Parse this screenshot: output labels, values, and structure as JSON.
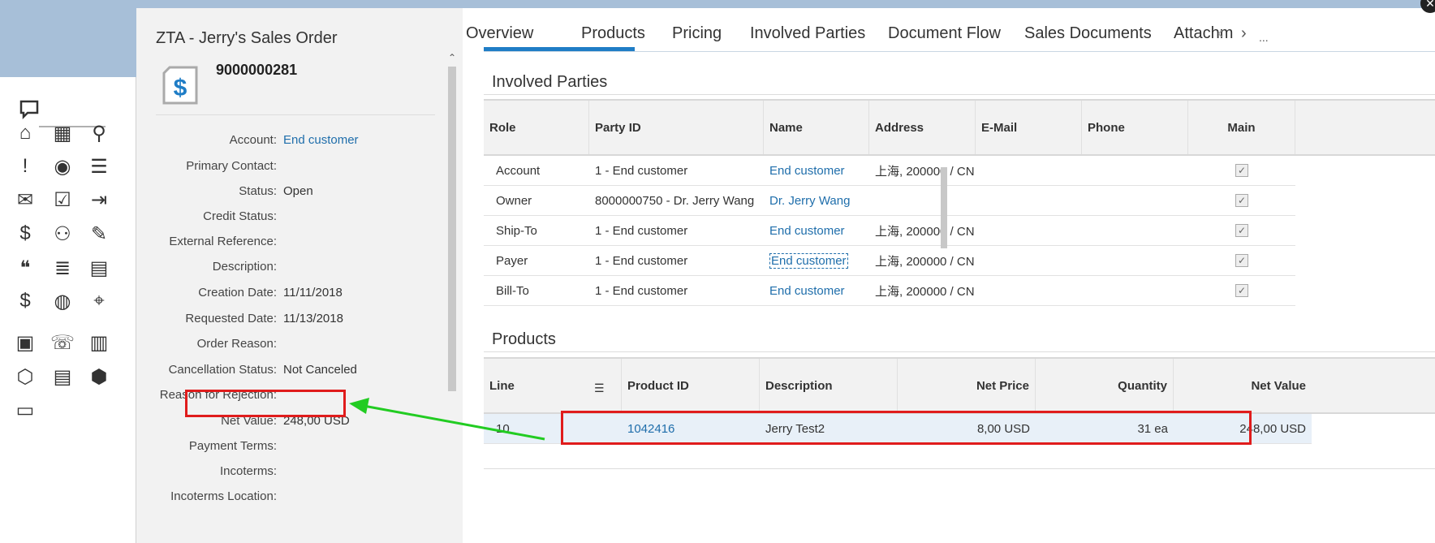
{
  "header": {
    "title": "ZTA - Jerry's Sales Order",
    "object_number": "9000000281"
  },
  "fields": [
    {
      "label": "Account:",
      "value": "End customer",
      "link": true
    },
    {
      "label": "Primary Contact:",
      "value": ""
    },
    {
      "label": "Status:",
      "value": "Open"
    },
    {
      "label": "Credit Status:",
      "value": ""
    },
    {
      "label": "External Reference:",
      "value": ""
    },
    {
      "label": "Description:",
      "value": ""
    },
    {
      "label": "Creation Date:",
      "value": "11/11/2018"
    },
    {
      "label": "Requested Date:",
      "value": "11/13/2018"
    },
    {
      "label": "Order Reason:",
      "value": ""
    },
    {
      "label": "Cancellation Status:",
      "value": "Not Canceled"
    },
    {
      "label": "Reason for Rejection:",
      "value": ""
    },
    {
      "label": "Net Value:",
      "value": "248,00 USD"
    },
    {
      "label": "Payment Terms:",
      "value": ""
    },
    {
      "label": "Incoterms:",
      "value": ""
    },
    {
      "label": "Incoterms Location:",
      "value": ""
    }
  ],
  "tabs": [
    "Overview",
    "Products",
    "Pricing",
    "Involved Parties",
    "Document Flow",
    "Sales Documents",
    "Attachm"
  ],
  "tab_nav": {
    "prev": "‹",
    "next": "›",
    "more": "..."
  },
  "involved_parties": {
    "title": "Involved Parties",
    "columns": [
      "Role",
      "Party ID",
      "Name",
      "Address",
      "E-Mail",
      "Phone",
      "Main"
    ],
    "rows": [
      {
        "role": "Account",
        "party_id": "1 - End customer",
        "name": "End customer",
        "address": "上海, 200000 / CN",
        "email": "",
        "phone": "",
        "main": true
      },
      {
        "role": "Owner",
        "party_id": "8000000750 - Dr. Jerry Wang",
        "name": "Dr. Jerry Wang",
        "address": "",
        "email": "",
        "phone": "",
        "main": true
      },
      {
        "role": "Ship-To",
        "party_id": "1 - End customer",
        "name": "End customer",
        "address": "上海, 200000 / CN",
        "email": "",
        "phone": "",
        "main": true
      },
      {
        "role": "Payer",
        "party_id": "1 - End customer",
        "name": "End customer",
        "address": "上海, 200000 / CN",
        "email": "",
        "phone": "",
        "main": true
      },
      {
        "role": "Bill-To",
        "party_id": "1 - End customer",
        "name": "End customer",
        "address": "上海, 200000 / CN",
        "email": "",
        "phone": "",
        "main": true
      }
    ]
  },
  "products": {
    "title": "Products",
    "columns": [
      "Line",
      "Product ID",
      "Description",
      "Net Price",
      "Quantity",
      "Net Value"
    ],
    "rows": [
      {
        "line": "10",
        "product_id": "1042416",
        "description": "Jerry Test2",
        "net_price": "8,00  USD",
        "quantity": "31  ea",
        "net_value": "248,00  USD"
      }
    ]
  },
  "launcher_icons": [
    "feedback-icon",
    "home-icon",
    "calendar-icon",
    "search-icon",
    "alert-icon",
    "person-icon",
    "contacts-icon",
    "mail-icon",
    "checklist-icon",
    "transfer-money-icon",
    "dollar-icon",
    "org-icon",
    "edit-doc-icon",
    "quote-icon",
    "list-icon",
    "notebook-icon",
    "invoice-icon",
    "globe-money-icon",
    "map-pin-icon",
    "appointment-icon",
    "phone-book-icon",
    "clipboard-icon",
    "box-icon",
    "document-icon",
    "package-icon",
    "car-icon"
  ],
  "colors": {
    "link": "#1f6eab",
    "accent": "#1f7dc6",
    "highlight": "#e01c1c",
    "arrow": "#22cc22"
  }
}
